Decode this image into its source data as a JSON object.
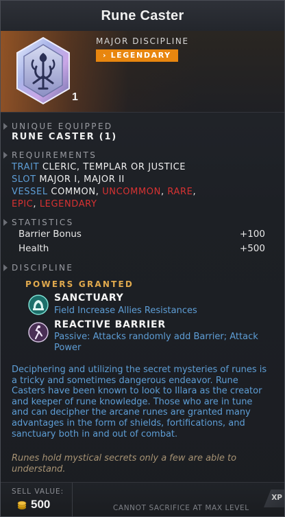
{
  "title": "Rune Caster",
  "hero": {
    "discipline_type": "MAJOR DISCIPLINE",
    "rarity": "LEGENDARY",
    "stack_count": "1",
    "icon": "rune-caster-icon"
  },
  "unique_equipped": {
    "header": "UNIQUE EQUIPPED",
    "value": "RUNE CASTER (1)"
  },
  "requirements": {
    "header": "REQUIREMENTS",
    "trait_label": "TRAIT",
    "trait_value": "CLERIC, TEMPLAR OR JUSTICE",
    "slot_label": "SLOT",
    "slot_value": "MAJOR I, MAJOR II",
    "vessel_label": "VESSEL",
    "vessel_common": "COMMON,",
    "vessel_uncommon": "UNCOMMON",
    "vessel_rare": "RARE",
    "vessel_epic": "EPIC",
    "vessel_legendary": "LEGENDARY",
    "sep": ","
  },
  "statistics": {
    "header": "STATISTICS",
    "rows": [
      {
        "label": "Barrier Bonus",
        "value": "+100"
      },
      {
        "label": "Health",
        "value": "+500"
      }
    ]
  },
  "discipline": {
    "header": "DISCIPLINE",
    "powers_title": "POWERS GRANTED",
    "powers": [
      {
        "name": "SANCTUARY",
        "desc": "Field Increase Allies Resistances",
        "icon": "sanctuary-icon"
      },
      {
        "name": "REACTIVE BARRIER",
        "desc": "Passive: Attacks randomly add Barrier; Attack Power",
        "icon": "reactive-barrier-icon"
      }
    ]
  },
  "lore": "Deciphering and utilizing the secret mysteries of runes is a tricky and sometimes dangerous endeavor. Rune Casters have been known to look to Illara as the creator and keeper of rune knowledge. Those who are in tune and can decipher the arcane runes are granted many advantages in the form of shields, fortifications, and sanctuary both in and out of combat.",
  "flavor": "Runes hold mystical secrets only a few are able to understand.",
  "footer": {
    "sell_label": "SELL VALUE:",
    "sell_value": "500",
    "sacrifice_text": "CANNOT SACRIFICE AT MAX LEVEL",
    "xp_badge": "XP"
  },
  "colors": {
    "legendary_badge": "#e8860f",
    "blue_text": "#5e9ed6",
    "red_text": "#d83232",
    "gold_header": "#e0a94d"
  }
}
